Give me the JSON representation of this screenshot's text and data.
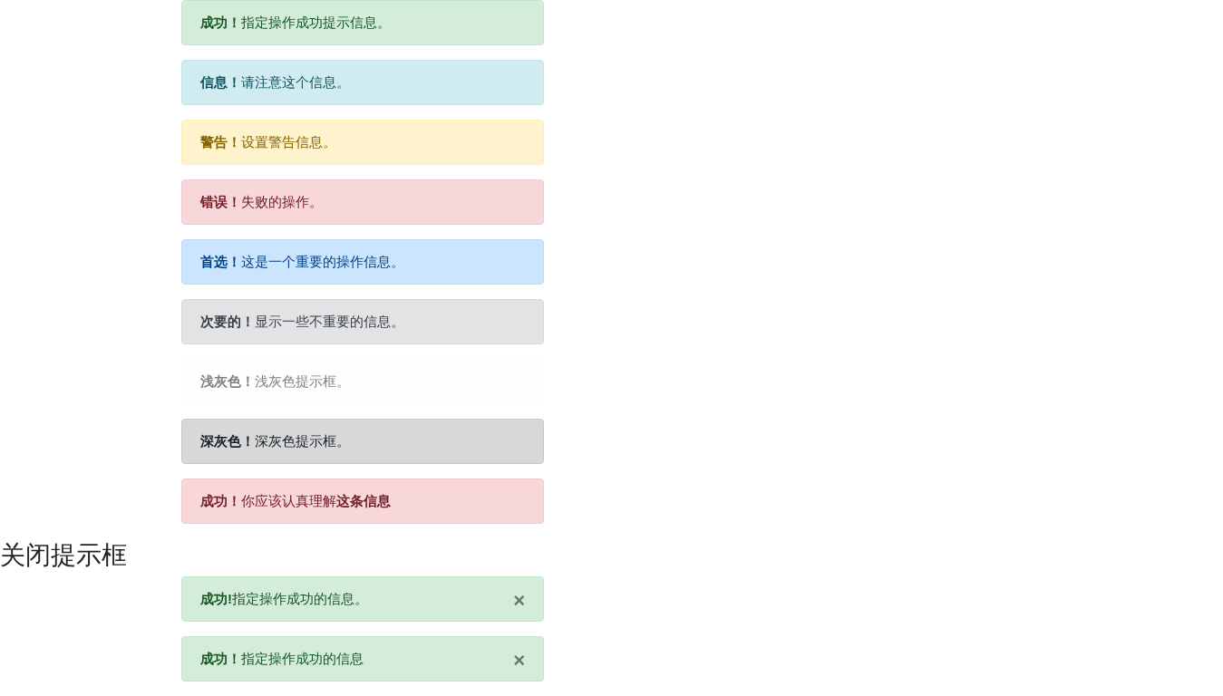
{
  "alerts": [
    {
      "kind": "success",
      "text": "**成功！**指定操作成功提示信息。"
    },
    {
      "kind": "info",
      "text": "**信息！**请注意这个信息。"
    },
    {
      "kind": "warning",
      "text": "**警告！**设置警告信息。"
    },
    {
      "kind": "danger",
      "text": "**错误！**失败的操作。"
    },
    {
      "kind": "primary",
      "text": "**首选！**这是一个重要的操作信息。"
    },
    {
      "kind": "secondary",
      "text": "**次要的！**显示一些不重要的信息。"
    },
    {
      "kind": "light",
      "text": "**浅灰色！**浅灰色提示框。"
    },
    {
      "kind": "dark",
      "text": "**深灰色！**深灰色提示框。"
    },
    {
      "kind": "danger",
      "text": "**成功！**你应该认真理解**这条信息**"
    }
  ],
  "dismissible_section": {
    "heading": "关闭提示框",
    "alerts": [
      {
        "kind": "success",
        "text": "**成功!**指定操作成功的信息。",
        "close": "×"
      },
      {
        "kind": "success",
        "text": "**成功！**指定操作成功的信息",
        "close": "×"
      }
    ]
  }
}
